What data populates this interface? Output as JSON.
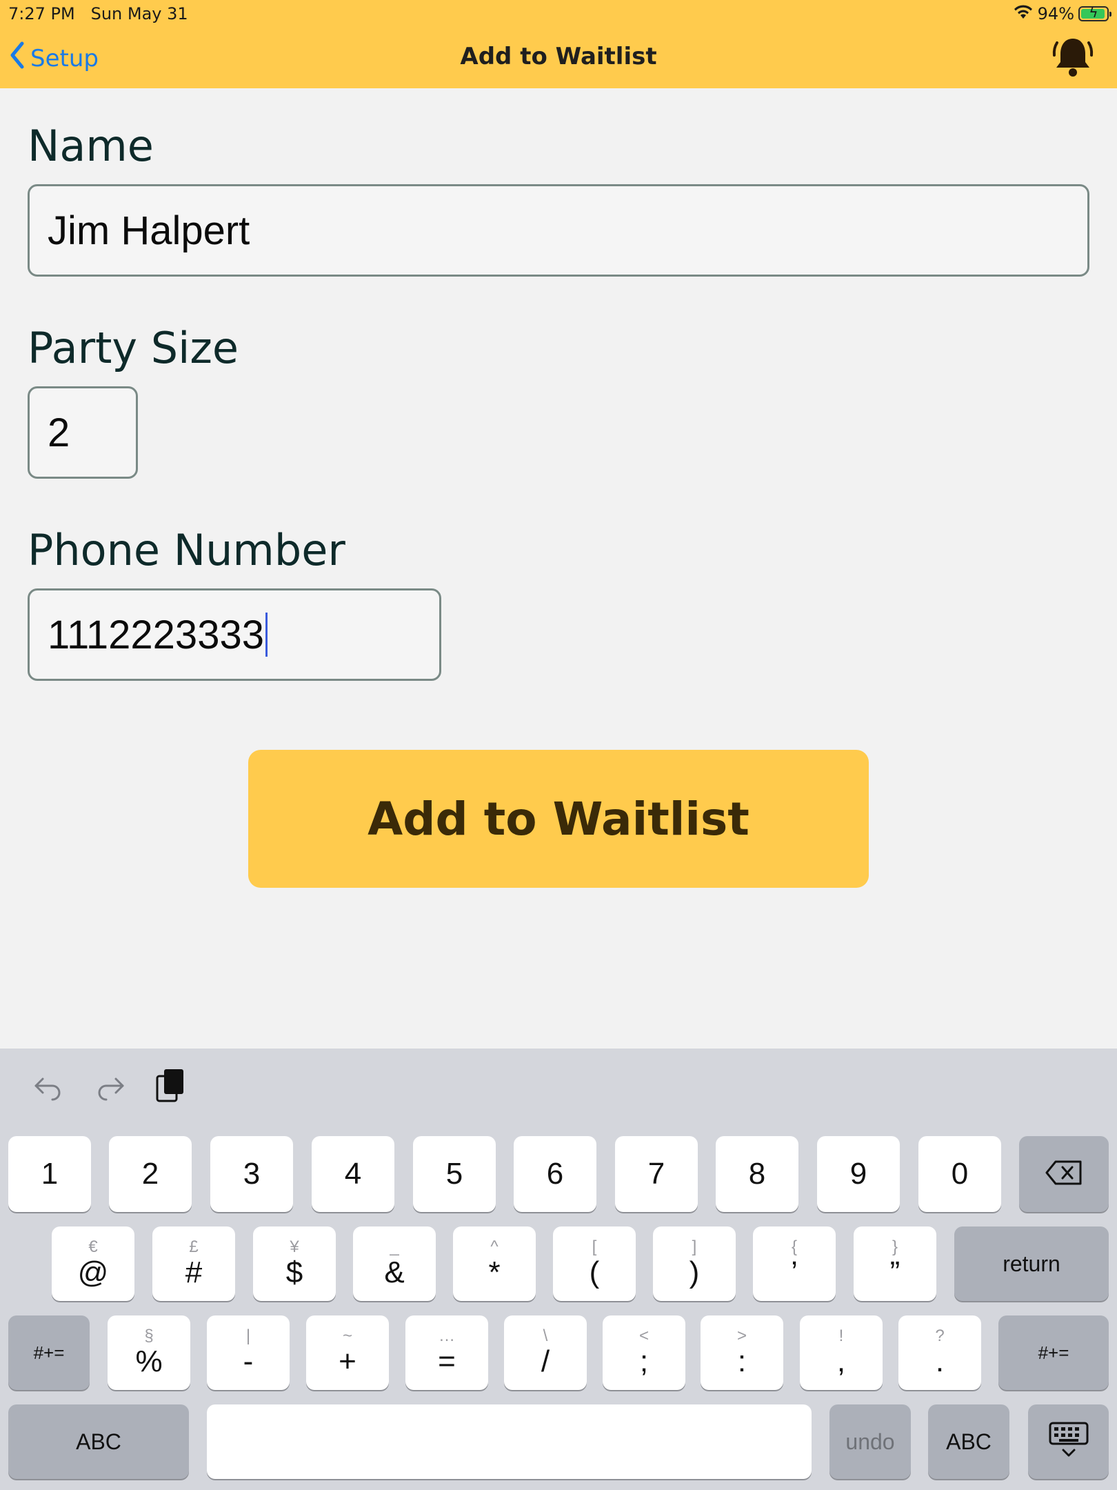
{
  "status": {
    "time": "7:27 PM   Sun May 31",
    "battery": "94%"
  },
  "nav": {
    "back_label": "Setup",
    "title": "Add to Waitlist"
  },
  "form": {
    "name_label": "Name",
    "name_value": "Jim Halpert",
    "party_label": "Party Size",
    "party_value": "2",
    "phone_label": "Phone Number",
    "phone_value": "1112223333"
  },
  "button": {
    "label": "Add to Waitlist"
  },
  "colors": {
    "accent": "#ffcb4d",
    "link": "#1a7ae6"
  },
  "keyboard": {
    "row1": [
      {
        "main": "1"
      },
      {
        "main": "2"
      },
      {
        "main": "3"
      },
      {
        "main": "4"
      },
      {
        "main": "5"
      },
      {
        "main": "6"
      },
      {
        "main": "7"
      },
      {
        "main": "8"
      },
      {
        "main": "9"
      },
      {
        "main": "0"
      }
    ],
    "row2": [
      {
        "alt": "€",
        "main": "@"
      },
      {
        "alt": "£",
        "main": "#"
      },
      {
        "alt": "¥",
        "main": "$"
      },
      {
        "alt": "_",
        "main": "&"
      },
      {
        "alt": "^",
        "main": "*"
      },
      {
        "alt": "[",
        "main": "("
      },
      {
        "alt": "]",
        "main": ")"
      },
      {
        "alt": "{",
        "main": "’"
      },
      {
        "alt": "}",
        "main": "”"
      }
    ],
    "row3": [
      {
        "alt": "§",
        "main": "%"
      },
      {
        "alt": "|",
        "main": "-"
      },
      {
        "alt": "~",
        "main": "+"
      },
      {
        "alt": "…",
        "main": "="
      },
      {
        "alt": "\\",
        "main": "/"
      },
      {
        "alt": "<",
        "main": ";"
      },
      {
        "alt": ">",
        "main": ":"
      },
      {
        "alt": "!",
        "main": ","
      },
      {
        "alt": "?",
        "main": "."
      }
    ],
    "return_label": "return",
    "symbols_label": "#+=",
    "abc_label": "ABC",
    "undo_label": "undo"
  }
}
